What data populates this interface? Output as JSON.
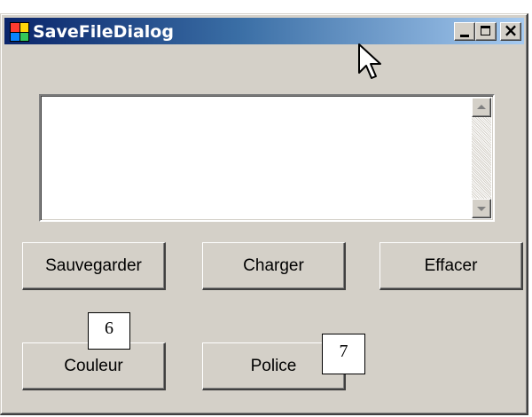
{
  "window": {
    "title": "SaveFileDialog",
    "title_bar_colors": [
      "#0a246a",
      "#a6caf0"
    ],
    "icons": {
      "app": "app-icon",
      "minimize": "minimize-icon",
      "maximize": "maximize-icon",
      "close": "close-icon"
    },
    "close_glyph": "×"
  },
  "textarea": {
    "value": "",
    "scroll_up": "scroll-up-arrow-icon",
    "scroll_down": "scroll-down-arrow-icon"
  },
  "buttons": {
    "save": "Sauvegarder",
    "load": "Charger",
    "clear": "Effacer",
    "color": "Couleur",
    "font": "Police"
  },
  "callouts": {
    "color_num": "6",
    "font_num": "7"
  },
  "cursor": "mouse-pointer-icon"
}
